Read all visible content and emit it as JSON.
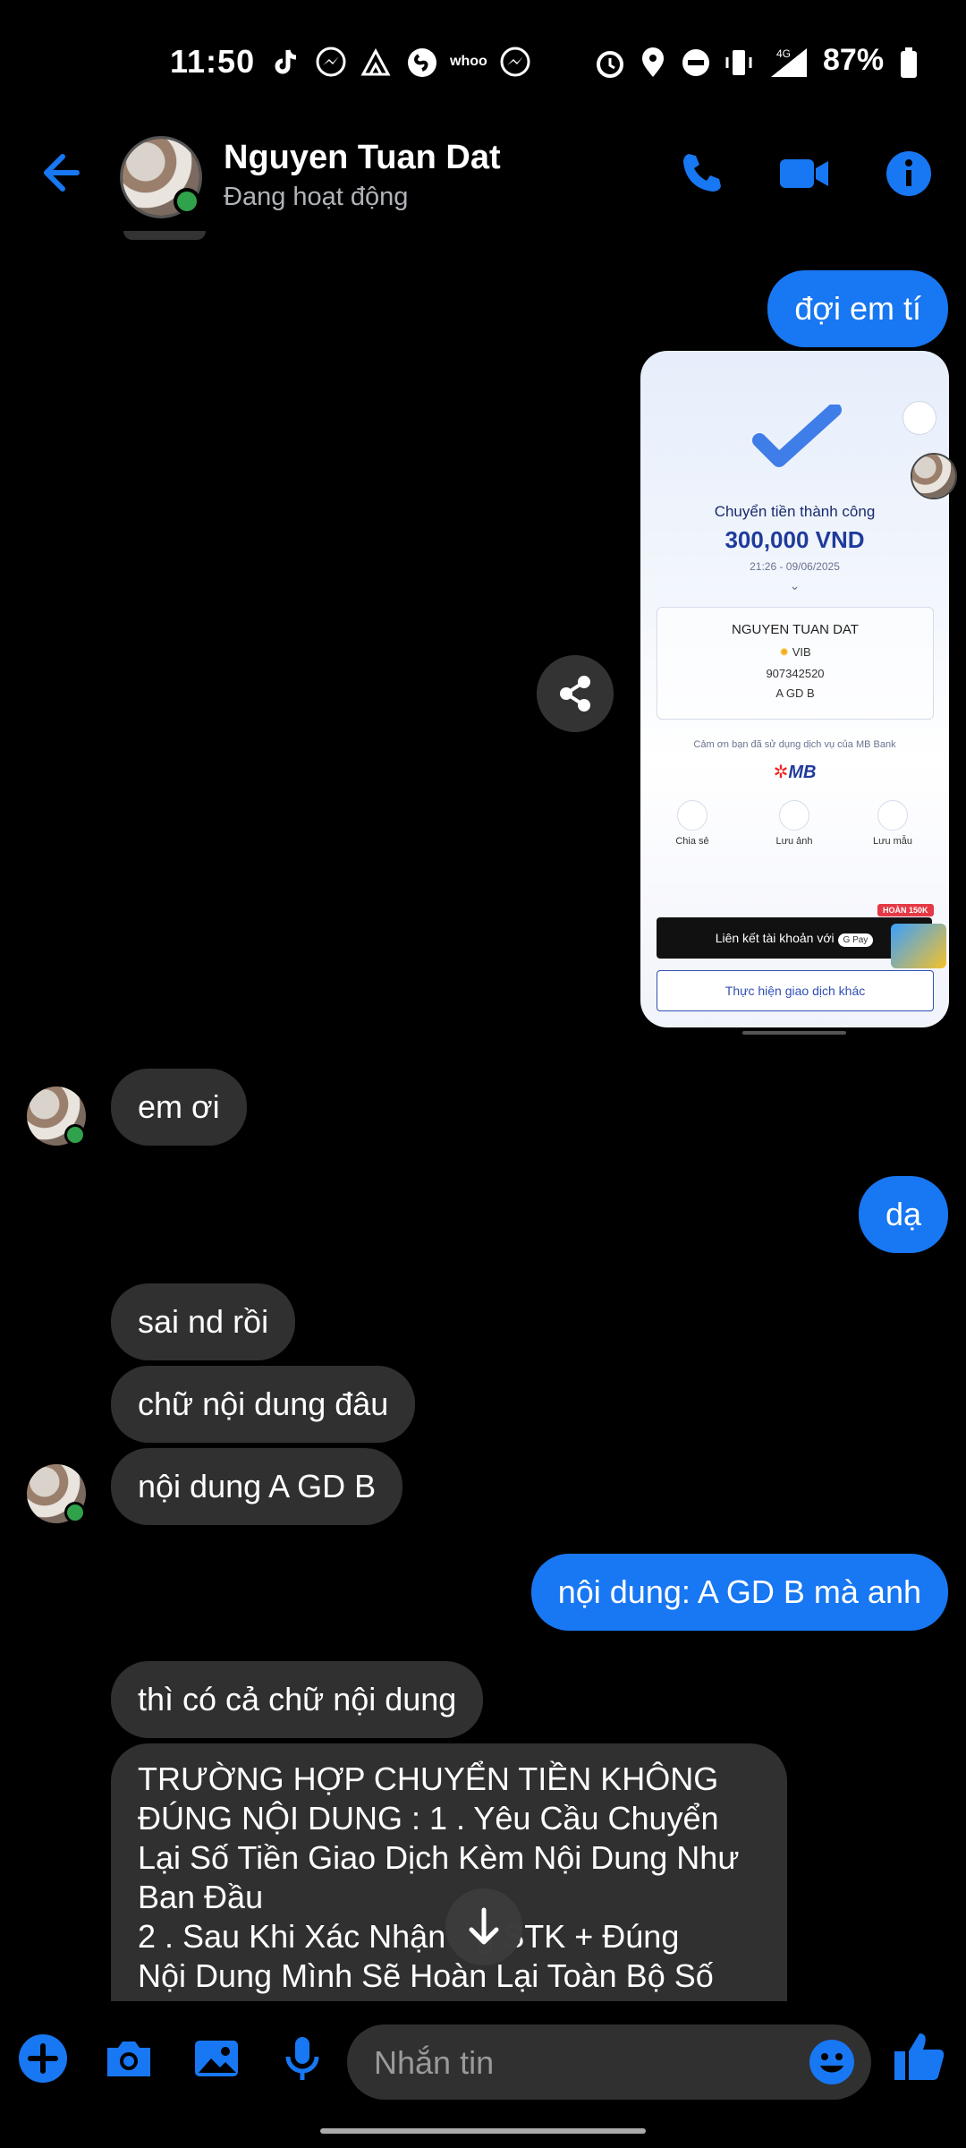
{
  "status_bar": {
    "time": "11:50",
    "battery": "87%",
    "network": "4G"
  },
  "header": {
    "name": "Nguyen Tuan Dat",
    "status": "Đang hoạt động"
  },
  "messages": {
    "m1": "đợi em tí",
    "m2": "em ơi",
    "m3": "dạ",
    "m4": "sai nd rồi",
    "m5": "chữ nội dung đâu",
    "m6": "nội dung A GD B",
    "m7": "nội dung: A GD B mà anh",
    "m8": "thì có cả chữ nội dung",
    "m9_l1": "TRƯỜNG HỢP CHUYỂN TIỀN KHÔNG",
    "m9_l2": "ĐÚNG NỘI DUNG :   1 . Yêu Cầu Chuyển",
    "m9_l3": "Lại  Số Tiền Giao Dịch Kèm Nội Dung Như",
    "m9_l4": "Ban Đầu",
    "m9_l5": "2 . Sau Khi Xác Nhận",
    "m9_l5b": "g STK + Đúng",
    "m9_l6": "Nội Dung Mình Sẽ Hoàn Lại Toàn Bộ Số"
  },
  "receipt": {
    "title": "Chuyển tiền thành công",
    "amount": "300,000 VND",
    "datetime": "21:26 - 09/06/2025",
    "recipient": "NGUYEN TUAN DAT",
    "bank": "VIB",
    "account": "907342520",
    "memo": "A GD B",
    "thanks": "Cảm ơn bạn đã sử dụng dịch vụ của MB Bank",
    "bank_logo": "MB",
    "action_share": "Chia sẻ",
    "action_save": "Lưu ảnh",
    "action_template": "Lưu mẫu",
    "badge": "HOÀN 150K",
    "link_button": "Liên kết tài khoản với",
    "gpay": "G Pay",
    "other_button": "Thực hiện giao dịch khác"
  },
  "composer": {
    "placeholder": "Nhắn tin"
  },
  "colors": {
    "accent": "#1877f2",
    "incoming": "#303030",
    "online": "#31a24c"
  }
}
